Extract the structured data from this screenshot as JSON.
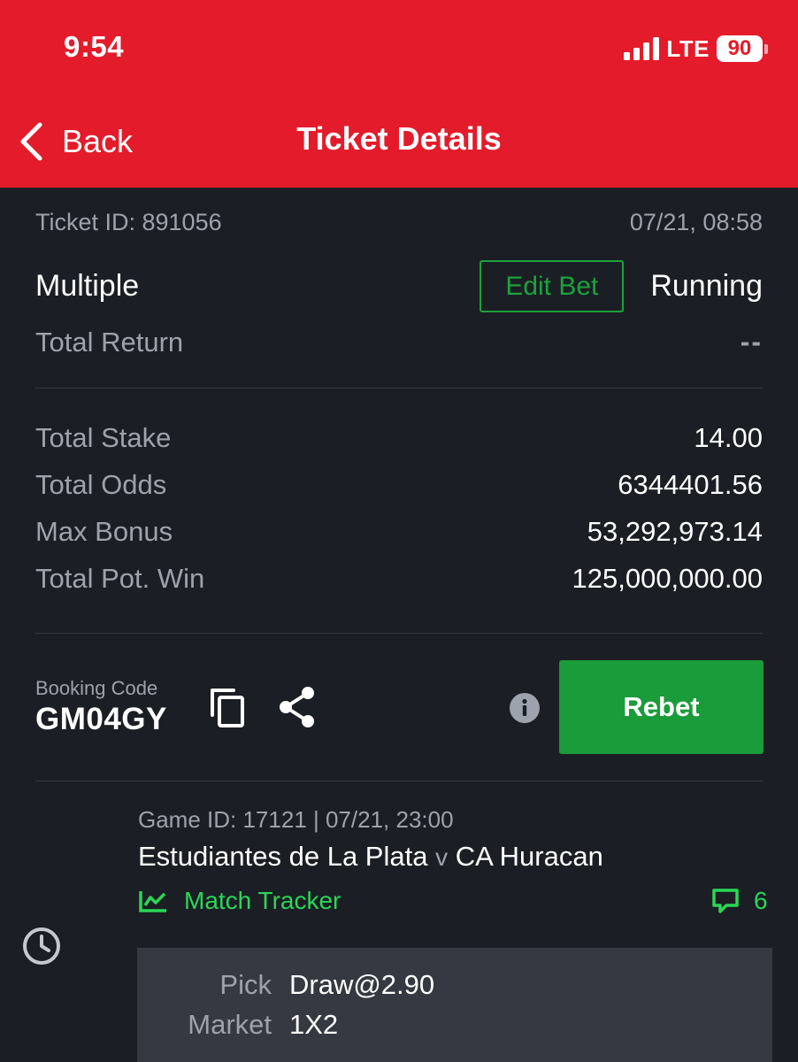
{
  "status_bar": {
    "time": "9:54",
    "network": "LTE",
    "battery": "90"
  },
  "nav": {
    "back_label": "Back",
    "title": "Ticket Details"
  },
  "ticket": {
    "id_label": "Ticket ID: 891056",
    "datetime": "07/21, 08:58",
    "type": "Multiple",
    "edit_label": "Edit Bet",
    "status": "Running",
    "total_return_label": "Total Return",
    "total_return_value": "--",
    "summary": [
      {
        "label": "Total Stake",
        "value": "14.00"
      },
      {
        "label": "Total Odds",
        "value": "6344401.56"
      },
      {
        "label": "Max Bonus",
        "value": "53,292,973.14"
      },
      {
        "label": "Total Pot. Win",
        "value": "125,000,000.00"
      }
    ]
  },
  "booking": {
    "label": "Booking Code",
    "code": "GM04GY",
    "rebet_label": "Rebet"
  },
  "selection": {
    "game_meta": "Game ID: 17121 | 07/21, 23:00",
    "home": "Estudiantes de La Plata",
    "vs": "v",
    "away": "CA Huracan",
    "tracker_label": "Match Tracker",
    "comments_count": "6",
    "details": [
      {
        "label": "Pick",
        "value": "Draw@2.90"
      },
      {
        "label": "Market",
        "value": "1X2"
      }
    ]
  },
  "colors": {
    "header_red": "#e41b2a",
    "background": "#1b1e24",
    "accent_green": "#1b9c3a",
    "tracker_green": "#2bd657"
  },
  "icons": [
    "chevron-left-icon",
    "copy-icon",
    "share-icon",
    "info-icon",
    "chart-icon",
    "comment-icon",
    "clock-icon"
  ]
}
